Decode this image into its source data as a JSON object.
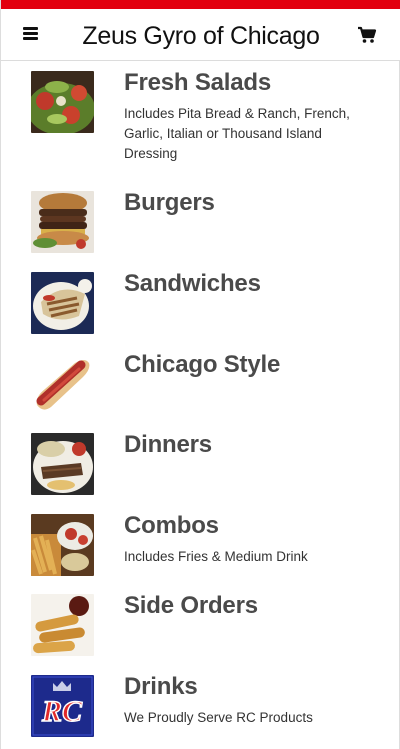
{
  "header": {
    "title": "Zeus Gyro of Chicago",
    "menu_icon": "hamburger-menu-icon",
    "cart_icon": "shopping-cart-icon"
  },
  "colors": {
    "brand_red": "#e2000f",
    "title_text": "#4a4a4a"
  },
  "menu": {
    "items": [
      {
        "title": "Fresh Salads",
        "description": "Includes Pita Bread & Ranch, French, Garlic, Italian or Thousand Island Dressing",
        "image": "salad-photo"
      },
      {
        "title": "Burgers",
        "description": "",
        "image": "burger-photo"
      },
      {
        "title": "Sandwiches",
        "description": "",
        "image": "gyro-sandwich-photo"
      },
      {
        "title": "Chicago Style",
        "description": "",
        "image": "hot-dog-photo"
      },
      {
        "title": "Dinners",
        "description": "",
        "image": "dinner-plate-photo"
      },
      {
        "title": "Combos",
        "description": "Includes Fries & Medium Drink",
        "image": "combo-fries-photo"
      },
      {
        "title": "Side Orders",
        "description": "",
        "image": "mozzarella-sticks-photo"
      },
      {
        "title": "Drinks",
        "description": "We Proudly Serve RC Products",
        "image": "rc-cola-logo"
      }
    ]
  }
}
